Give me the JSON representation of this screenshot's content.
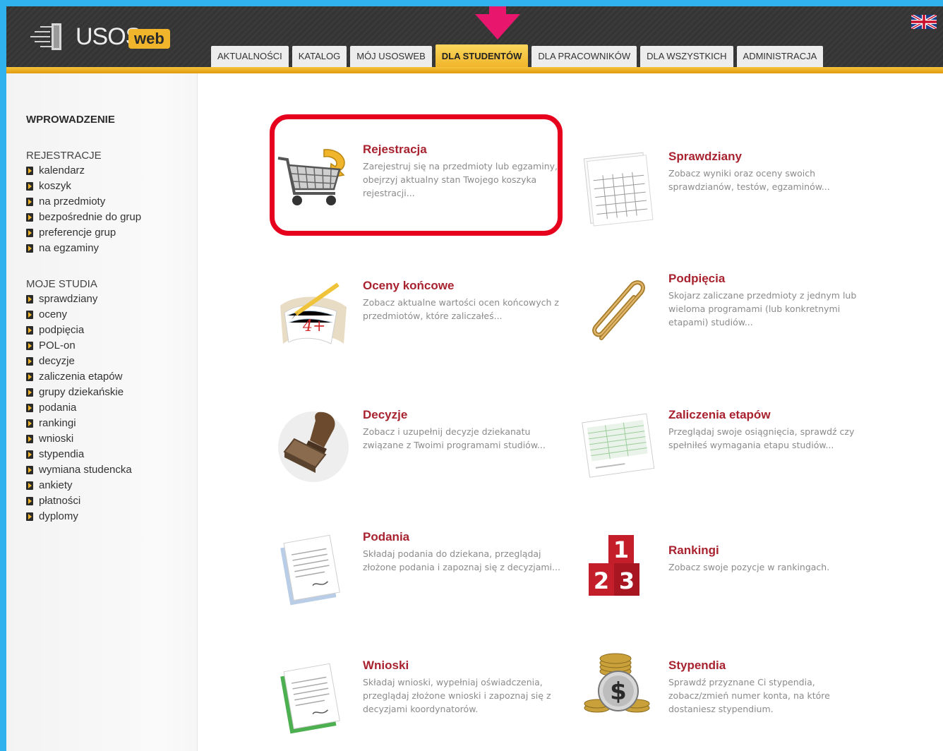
{
  "logo": {
    "text": "USOS",
    "badge": "web"
  },
  "tabs": [
    {
      "label": "AKTUALNOŚCI"
    },
    {
      "label": "KATALOG"
    },
    {
      "label": "MÓJ USOSWEB"
    },
    {
      "label": "DLA STUDENTÓW",
      "active": true
    },
    {
      "label": "DLA PRACOWNIKÓW"
    },
    {
      "label": "DLA WSZYSTKICH"
    },
    {
      "label": "ADMINISTRACJA"
    }
  ],
  "sidebar": {
    "title": "WPROWADZENIE",
    "sections": [
      {
        "heading": "REJESTRACJE",
        "items": [
          "kalendarz",
          "koszyk",
          "na przedmioty",
          "bezpośrednie do grup",
          "preferencje grup",
          "na egzaminy"
        ]
      },
      {
        "heading": "MOJE STUDIA",
        "items": [
          "sprawdziany",
          "oceny",
          "podpięcia",
          "POL-on",
          "decyzje",
          "zaliczenia etapów",
          "grupy dziekańskie",
          "podania",
          "rankingi",
          "wnioski",
          "stypendia",
          "wymiana studencka",
          "ankiety",
          "płatności",
          "dyplomy"
        ]
      }
    ]
  },
  "tiles": [
    {
      "title": "Rejestracja",
      "desc": "Zarejestruj się na przedmioty lub egzaminy, obejrzyj aktualny stan Twojego koszyka rejestracji...",
      "icon": "shopping-cart-icon"
    },
    {
      "title": "Sprawdziany",
      "desc": "Zobacz wyniki oraz oceny swoich sprawdzianów, testów, egzaminów...",
      "icon": "test-sheet-icon"
    },
    {
      "title": "Oceny końcowe",
      "desc": "Zobacz aktualne wartości ocen końcowych z przedmiotów, które zaliczałeś...",
      "icon": "grade-book-icon",
      "grade": "4+"
    },
    {
      "title": "Podpięcia",
      "desc": "Skojarz zaliczane przedmioty z jednym lub wieloma programami (lub konkretnymi etapami) studiów...",
      "icon": "paperclip-icon"
    },
    {
      "title": "Decyzje",
      "desc": "Zobacz i uzupełnij decyzje dziekanatu związane z Twoimi programami studiów...",
      "icon": "stamp-icon"
    },
    {
      "title": "Zaliczenia etapów",
      "desc": "Przeglądaj swoje osiągnięcia, sprawdź czy spełniłeś wymagania etapu studiów...",
      "icon": "spreadsheet-icon"
    },
    {
      "title": "Podania",
      "desc": "Składaj podania do dziekana, przeglądaj złożone podania i zapoznaj się z decyzjami...",
      "icon": "document-stack-icon"
    },
    {
      "title": "Rankingi",
      "desc": "Zobacz swoje pozycje w rankingach.",
      "icon": "podium-icon",
      "digits": [
        "1",
        "2",
        "3"
      ]
    },
    {
      "title": "Wnioski",
      "desc": "Składaj wnioski, wypełniaj oświadczenia, przeglądaj złożone wnioski i zapoznaj się z decyzjami koordynatorów.",
      "icon": "document-green-icon"
    },
    {
      "title": "Stypendia",
      "desc": "Sprawdź przyznane Ci stypendia, zobacz/zmień numer konta, na które dostaniesz stypendium.",
      "icon": "coins-dollar-icon",
      "symbol": "$"
    }
  ],
  "colors": {
    "accent": "#f0b52b",
    "title": "#a8222f",
    "highlight": "#e6001e",
    "arrow": "#e8166c"
  }
}
